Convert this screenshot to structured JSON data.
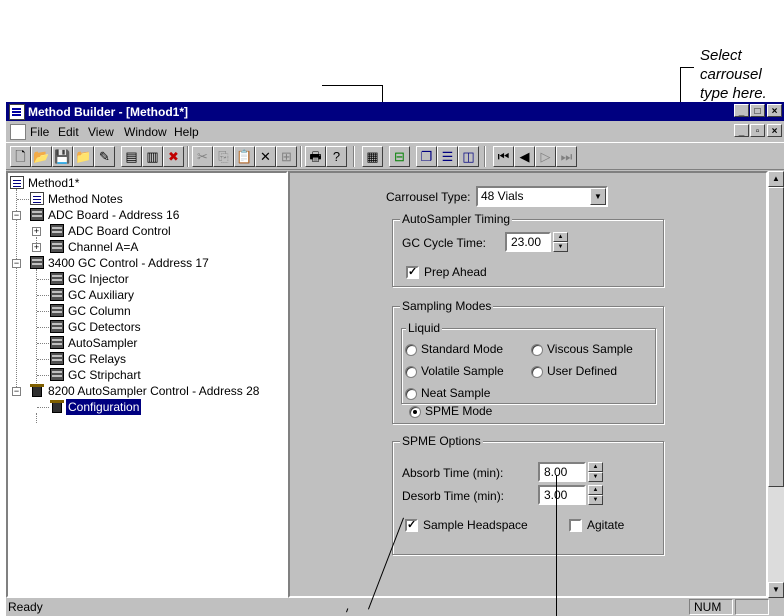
{
  "callout": {
    "line1": "Select carrousel",
    "line2": "type here."
  },
  "window": {
    "title": "Method Builder - [Method1*]"
  },
  "caption_buttons": {
    "minimize": "_",
    "maximize": "□",
    "close": "×"
  },
  "menubar": {
    "items": [
      "File",
      "Edit",
      "View",
      "Window",
      "Help"
    ],
    "mdi_minimize": "_",
    "mdi_restore": "▫",
    "mdi_close": "×"
  },
  "toolbar": {
    "icons": [
      "new-icon",
      "open-icon",
      "save-icon",
      "open-folder-icon",
      "wand-icon",
      "method-notes-icon",
      "import-icon",
      "delete-method-icon",
      "cut-icon",
      "copy-icon",
      "paste-icon",
      "delete-icon",
      "insert-icon",
      "print-icon",
      "help-icon",
      "tile-icon",
      "tree-icon",
      "cascade-icon",
      "split-horizontal-icon",
      "split-vertical-icon",
      "first-icon",
      "previous-icon",
      "next-icon",
      "last-icon"
    ]
  },
  "tree": {
    "root": "Method1*",
    "items": [
      {
        "label": "Method Notes"
      },
      {
        "label": "ADC Board - Address 16"
      },
      {
        "label": "ADC Board Control"
      },
      {
        "label": "Channel A=A"
      },
      {
        "label": "3400 GC Control - Address 17"
      },
      {
        "label": "GC Injector"
      },
      {
        "label": "GC Auxiliary"
      },
      {
        "label": "GC Column"
      },
      {
        "label": "GC Detectors"
      },
      {
        "label": "AutoSampler"
      },
      {
        "label": "GC Relays"
      },
      {
        "label": "GC Stripchart"
      },
      {
        "label": "8200 AutoSampler Control - Address 28"
      },
      {
        "label": "Configuration"
      }
    ]
  },
  "form": {
    "carrousel_label": "Carrousel Type:",
    "carrousel_value": "48 Vials",
    "timing_group": "AutoSampler Timing",
    "gc_cycle_label": "GC Cycle Time:",
    "gc_cycle_value": "23.00",
    "prep_ahead_label": "Prep Ahead",
    "prep_ahead_checked": true,
    "sampling_group": "Sampling Modes",
    "liquid_group": "Liquid",
    "modes": {
      "standard": "Standard Mode",
      "viscous": "Viscous Sample",
      "volatile": "Volatile Sample",
      "user_defined": "User Defined",
      "neat": "Neat Sample",
      "spme": "SPME Mode"
    },
    "selected_mode": "SPME Mode",
    "spme_group": "SPME Options",
    "absorb_label": "Absorb Time (min):",
    "absorb_value": "8.00",
    "desorb_label": "Desorb Time (min):",
    "desorb_value": "3.00",
    "headspace_label": "Sample Headspace",
    "headspace_checked": true,
    "agitate_label": "Agitate",
    "agitate_checked": false
  },
  "statusbar": {
    "text": "Ready",
    "num": "NUM"
  }
}
